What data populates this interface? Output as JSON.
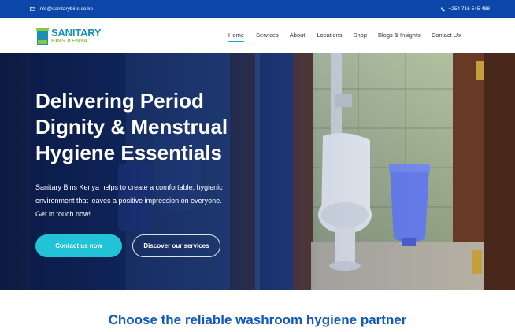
{
  "topbar": {
    "email": "info@sanitarybins.co.ke",
    "phone": "+254 716 545 488",
    "email_icon": "mail-icon",
    "phone_icon": "phone-icon"
  },
  "logo": {
    "line1": "SANITARY",
    "line2": "BINS KENYA"
  },
  "nav": {
    "items": [
      {
        "label": "Home",
        "active": true
      },
      {
        "label": "Services",
        "active": false
      },
      {
        "label": "About",
        "active": false
      },
      {
        "label": "Locations",
        "active": false
      },
      {
        "label": "Shop",
        "active": false
      },
      {
        "label": "Blogs & Insights",
        "active": false
      },
      {
        "label": "Contact Us",
        "active": false
      }
    ]
  },
  "hero": {
    "title_line1": "Delivering Period",
    "title_line2": "Dignity & Menstrual",
    "title_line3": "Hygiene Essentials",
    "subtitle_line1": "Sanitary Bins Kenya helps to create a comfortable, hygienic",
    "subtitle_line2": "environment that leaves a positive impression on everyone.",
    "subtitle_line3": "Get in touch now!",
    "primary_button": "Contact us now",
    "secondary_button": "Discover our services"
  },
  "section": {
    "title": "Choose the reliable washroom hygiene partner"
  },
  "colors": {
    "topbar": "#0c46a8",
    "accent": "#22c3d6",
    "heading_blue": "#1357b8",
    "logo_blue": "#1c8fb8",
    "logo_green": "#8cc63f"
  }
}
